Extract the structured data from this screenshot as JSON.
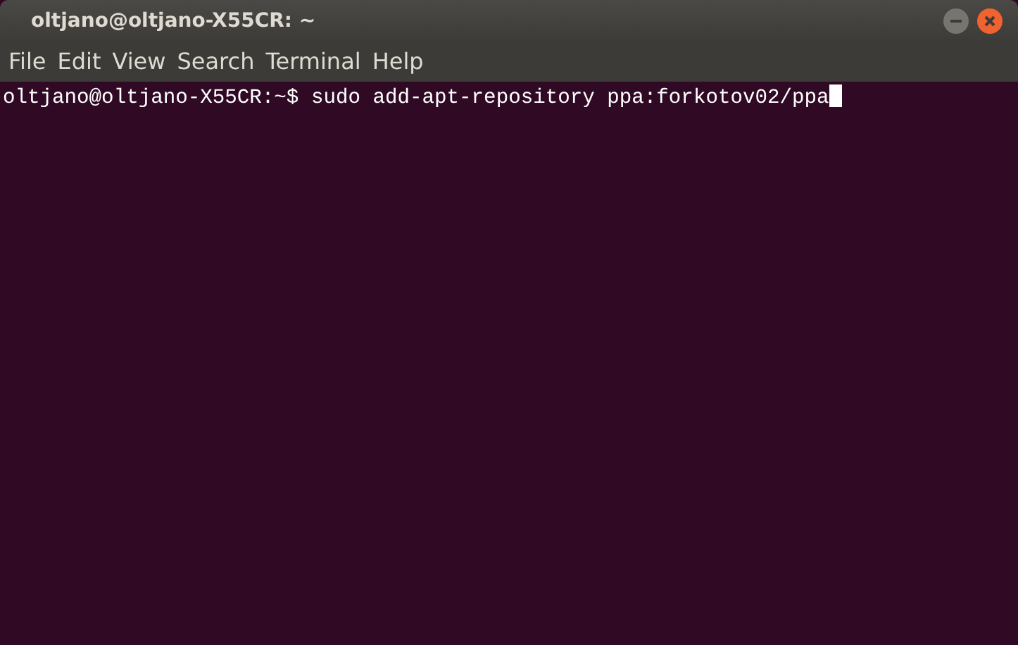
{
  "window": {
    "title": "oltjano@oltjano-X55CR: ~"
  },
  "menu": [
    "File",
    "Edit",
    "View",
    "Search",
    "Terminal",
    "Help"
  ],
  "terminal": {
    "lines": [
      {
        "prompt": "oltjano@oltjano-X55CR:~$",
        "command": "sudo add-apt-repository ppa:forkotov02/ppa",
        "cursor": true
      }
    ]
  }
}
